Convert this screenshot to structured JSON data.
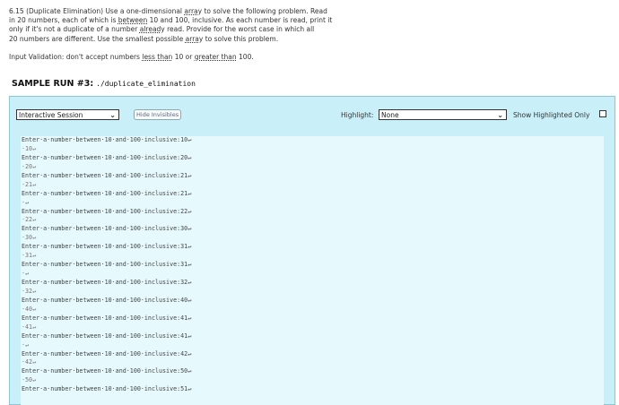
{
  "problem": {
    "line1_a": "6.15 (Duplicate Elimination) Use a one-dimensional ",
    "line1_link": "array",
    "line1_b": " to solve the following problem. Read",
    "line2_a": "in 20 numbers, each of which is ",
    "line2_link": "between",
    "line2_b": " 10 and 100, inclusive. As each number is read, print it",
    "line3_a": "only if it's not a duplicate of a number ",
    "line3_link": "already",
    "line3_b": " read. Provide for the worst case in which all",
    "line4_a": "20 numbers are different. Use the smallest possible ",
    "line4_link": "array",
    "line4_b": " to solve this problem."
  },
  "validation": {
    "a": "Input Validation: don't accept numbers ",
    "link1": "less than",
    "b": " 10 or ",
    "link2": "greater than",
    "c": " 100."
  },
  "sample": {
    "title": "SAMPLE RUN #3:",
    "command": "./duplicate_elimination"
  },
  "toolbar": {
    "session_value": "Interactive Session",
    "hide_button": "Hide Invisibles",
    "highlight_label": "Highlight:",
    "highlight_value": "None",
    "show_highlighted_label": "Show Highlighted Only"
  },
  "terminal": {
    "lines": [
      "Enter·a·number·between·10·and·100·inclusive:10↵",
      "·10↵",
      "Enter·a·number·between·10·and·100·inclusive:20↵",
      "·20↵",
      "Enter·a·number·between·10·and·100·inclusive:21↵",
      "·21↵",
      "Enter·a·number·between·10·and·100·inclusive:21↵",
      "·↵",
      "Enter·a·number·between·10·and·100·inclusive:22↵",
      "·22↵",
      "Enter·a·number·between·10·and·100·inclusive:30↵",
      "·30↵",
      "Enter·a·number·between·10·and·100·inclusive:31↵",
      "·31↵",
      "Enter·a·number·between·10·and·100·inclusive:31↵",
      "·↵",
      "Enter·a·number·between·10·and·100·inclusive:32↵",
      "·32↵",
      "Enter·a·number·between·10·and·100·inclusive:40↵",
      "·40↵",
      "Enter·a·number·between·10·and·100·inclusive:41↵",
      "·41↵",
      "Enter·a·number·between·10·and·100·inclusive:41↵",
      "·↵",
      "Enter·a·number·between·10·and·100·inclusive:42↵",
      "·42↵",
      "Enter·a·number·between·10·and·100·inclusive:50↵",
      "·50↵",
      "Enter·a·number·between·10·and·100·inclusive:51↵"
    ]
  }
}
